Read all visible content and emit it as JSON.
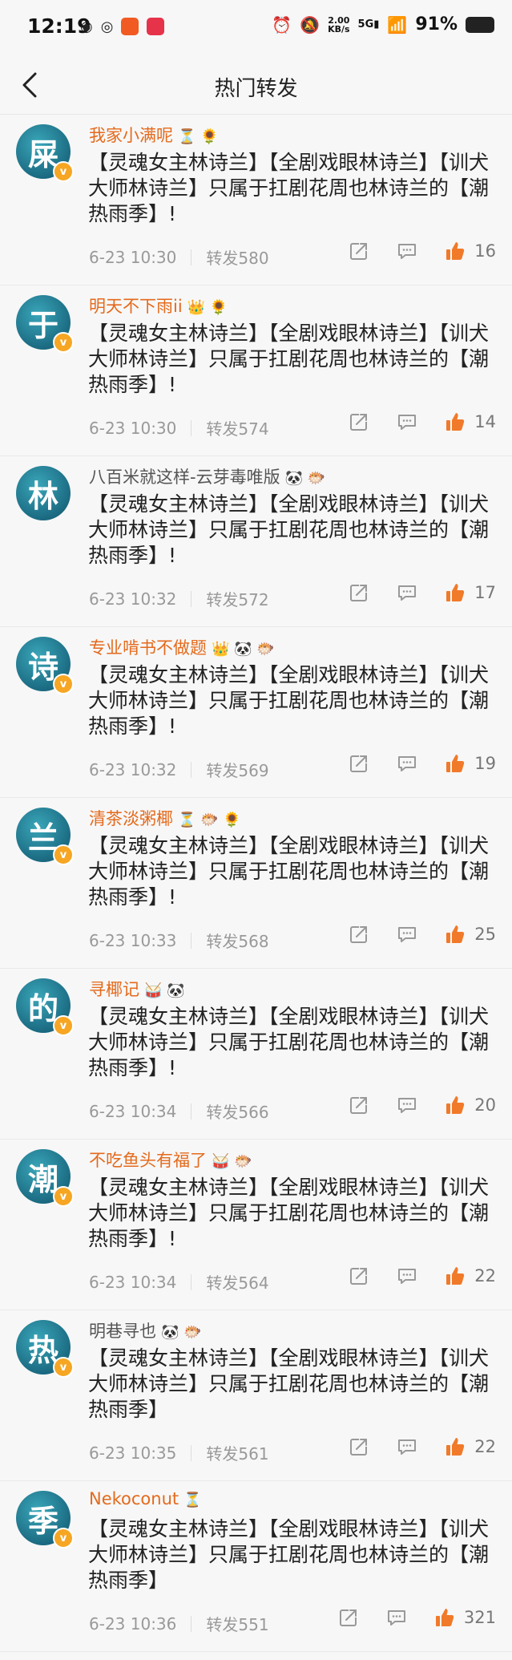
{
  "status_bar": {
    "time": "12:19",
    "net_speed": "2.00",
    "net_unit": "KB/s",
    "net_type": "5G",
    "battery": "91%"
  },
  "nav": {
    "title": "热门转发",
    "back_icon": "chevron-left-icon"
  },
  "colors": {
    "accent_orange": "#e46a1c",
    "like_orange": "#f07a2a",
    "avatar_teal": "#1b6b82",
    "vip_badge": "#f6a623"
  },
  "items": [
    {
      "avatar_char": "屎",
      "name": "我家小满呢",
      "name_color": "orange",
      "verified": true,
      "icons": [
        "⏳",
        "🌻"
      ],
      "text": "【灵魂女主林诗兰】【全剧戏眼林诗兰】【训犬大师林诗兰】只属于扛剧花周也林诗兰的【潮热雨季】!",
      "time": "6-23 10:30",
      "repost": "转发580",
      "likes": "16"
    },
    {
      "avatar_char": "于",
      "name": "明天不下雨ii",
      "name_color": "orange",
      "verified": true,
      "icons": [
        "👑",
        "🌻"
      ],
      "text": "【灵魂女主林诗兰】【全剧戏眼林诗兰】【训犬大师林诗兰】只属于扛剧花周也林诗兰的【潮热雨季】!",
      "time": "6-23 10:30",
      "repost": "转发574",
      "likes": "14"
    },
    {
      "avatar_char": "林",
      "name": "八百米就这样-云芽毒唯版",
      "name_color": "gray",
      "verified": false,
      "icons": [
        "🐼",
        "🐡"
      ],
      "text": "【灵魂女主林诗兰】【全剧戏眼林诗兰】【训犬大师林诗兰】只属于扛剧花周也林诗兰的【潮热雨季】!",
      "time": "6-23 10:32",
      "repost": "转发572",
      "likes": "17"
    },
    {
      "avatar_char": "诗",
      "name": "专业啃书不做题",
      "name_color": "orange",
      "verified": true,
      "icons": [
        "👑",
        "🐼",
        "🐡"
      ],
      "text": "【灵魂女主林诗兰】【全剧戏眼林诗兰】【训犬大师林诗兰】只属于扛剧花周也林诗兰的【潮热雨季】!",
      "time": "6-23 10:32",
      "repost": "转发569",
      "likes": "19"
    },
    {
      "avatar_char": "兰",
      "name": "清茶淡粥椰",
      "name_color": "orange",
      "verified": true,
      "icons": [
        "⏳",
        "🐡",
        "🌻"
      ],
      "text": "【灵魂女主林诗兰】【全剧戏眼林诗兰】【训犬大师林诗兰】只属于扛剧花周也林诗兰的【潮热雨季】!",
      "time": "6-23 10:33",
      "repost": "转发568",
      "likes": "25"
    },
    {
      "avatar_char": "的",
      "name": "寻椰记",
      "name_color": "orange",
      "verified": true,
      "icons": [
        "🥁",
        "🐼"
      ],
      "text": "【灵魂女主林诗兰】【全剧戏眼林诗兰】【训犬大师林诗兰】只属于扛剧花周也林诗兰的【潮热雨季】!",
      "time": "6-23 10:34",
      "repost": "转发566",
      "likes": "20"
    },
    {
      "avatar_char": "潮",
      "name": "不吃鱼头有福了",
      "name_color": "orange",
      "verified": true,
      "icons": [
        "🥁",
        "🐡"
      ],
      "text": "【灵魂女主林诗兰】【全剧戏眼林诗兰】【训犬大师林诗兰】只属于扛剧花周也林诗兰的【潮热雨季】!",
      "time": "6-23 10:34",
      "repost": "转发564",
      "likes": "22"
    },
    {
      "avatar_char": "热",
      "name": "明巷寻也",
      "name_color": "gray",
      "verified": true,
      "icons": [
        "🐼",
        "🐡"
      ],
      "text": "【灵魂女主林诗兰】【全剧戏眼林诗兰】【训犬大师林诗兰】只属于扛剧花周也林诗兰的【潮热雨季】",
      "time": "6-23 10:35",
      "repost": "转发561",
      "likes": "22"
    },
    {
      "avatar_char": "季",
      "name": "Nekoconut",
      "name_color": "orange",
      "verified": true,
      "icons": [
        "⏳"
      ],
      "text": "【灵魂女主林诗兰】【全剧戏眼林诗兰】【训犬大师林诗兰】只属于扛剧花周也林诗兰的【潮热雨季】",
      "time": "6-23 10:36",
      "repost": "转发551",
      "likes": "321"
    }
  ]
}
